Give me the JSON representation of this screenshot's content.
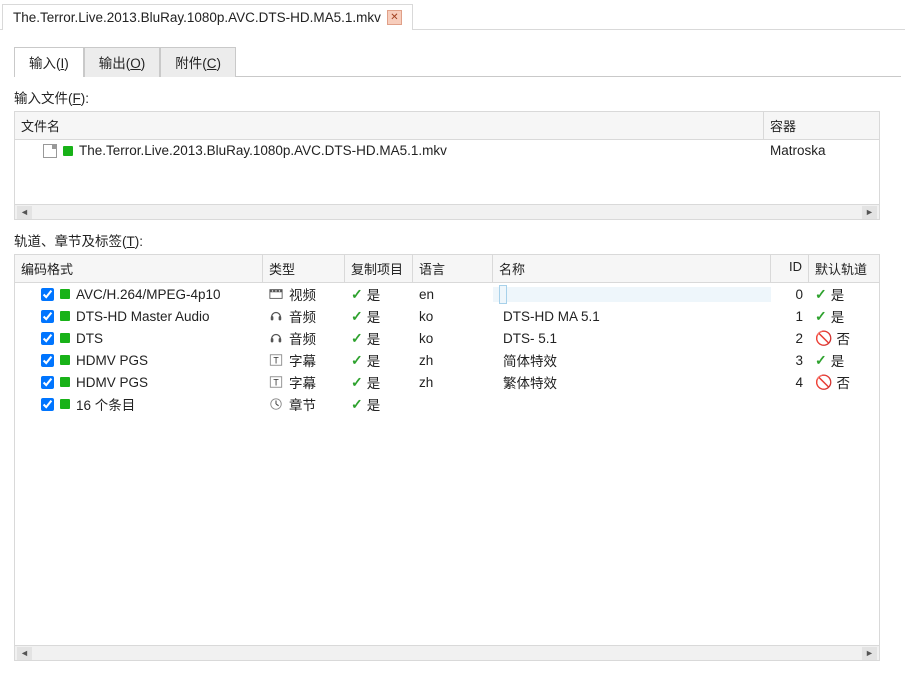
{
  "doc_tab": {
    "label": "The.Terror.Live.2013.BluRay.1080p.AVC.DTS-HD.MA5.1.mkv"
  },
  "tabs": {
    "input": {
      "pre": "输入(",
      "u": "I",
      "post": ")"
    },
    "output": {
      "pre": "输出(",
      "u": "O",
      "post": ")"
    },
    "attach": {
      "pre": "附件(",
      "u": "C",
      "post": ")"
    }
  },
  "labels": {
    "input_files": {
      "pre": "输入文件(",
      "u": "F",
      "post": "):"
    },
    "tracks": {
      "pre": "轨道、章节及标签(",
      "u": "T",
      "post": "):"
    }
  },
  "file_cols": {
    "name": "文件名",
    "container": "容器"
  },
  "files": [
    {
      "name": "The.Terror.Live.2013.BluRay.1080p.AVC.DTS-HD.MA5.1.mkv",
      "container": "Matroska"
    }
  ],
  "track_cols": {
    "fmt": "编码格式",
    "type": "类型",
    "copy": "复制项目",
    "lang": "语言",
    "name": "名称",
    "id": "ID",
    "def": "默认轨道"
  },
  "yes": "是",
  "no": "否",
  "tracks": [
    {
      "chk": true,
      "fmt": "AVC/H.264/MPEG-4p10",
      "type": "视频",
      "copy": true,
      "lang": "en",
      "name": "",
      "id": "0",
      "def": true,
      "selected": true,
      "icon": "video"
    },
    {
      "chk": true,
      "fmt": "DTS-HD Master Audio",
      "type": "音频",
      "copy": true,
      "lang": "ko",
      "name": "DTS-HD MA 5.1",
      "id": "1",
      "def": true,
      "icon": "audio"
    },
    {
      "chk": true,
      "fmt": "DTS",
      "type": "音频",
      "copy": true,
      "lang": "ko",
      "name": "DTS- 5.1",
      "id": "2",
      "def": false,
      "icon": "audio"
    },
    {
      "chk": true,
      "fmt": "HDMV PGS",
      "type": "字幕",
      "copy": true,
      "lang": "zh",
      "name": "简体特效",
      "id": "3",
      "def": true,
      "icon": "sub"
    },
    {
      "chk": true,
      "fmt": "HDMV PGS",
      "type": "字幕",
      "copy": true,
      "lang": "zh",
      "name": "繁体特效",
      "id": "4",
      "def": false,
      "icon": "sub"
    },
    {
      "chk": true,
      "fmt": "16 个条目",
      "type": "章节",
      "copy": true,
      "lang": "",
      "name": "",
      "id": "",
      "def": null,
      "icon": "chapter"
    }
  ]
}
